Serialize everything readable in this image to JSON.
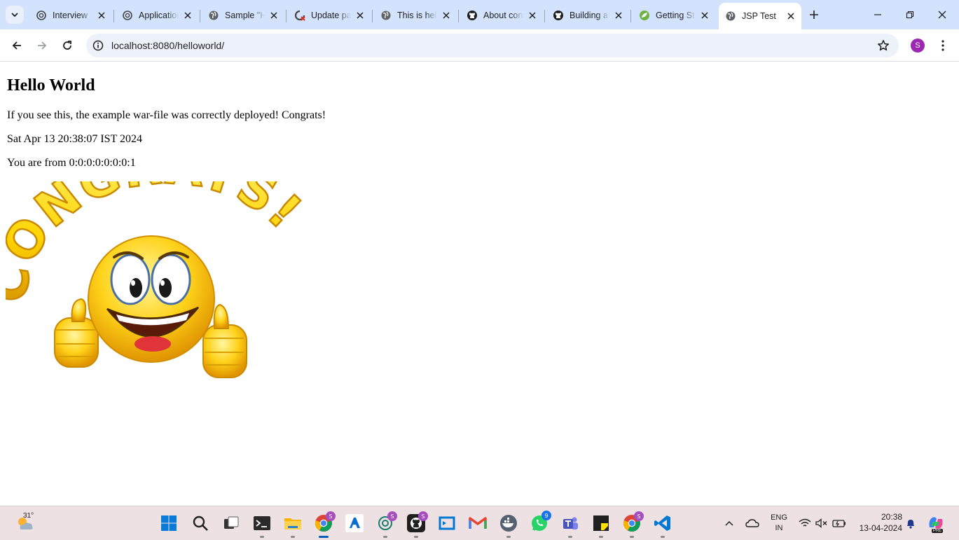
{
  "tabs": [
    {
      "title": "Interview",
      "icon": "openai-icon",
      "active": false
    },
    {
      "title": "Application",
      "icon": "openai-icon",
      "active": false
    },
    {
      "title": "Sample \"Hello",
      "icon": "globe-icon",
      "active": false
    },
    {
      "title": "Update page",
      "icon": "git-error-icon",
      "active": false
    },
    {
      "title": "This is help",
      "icon": "globe-icon",
      "active": false
    },
    {
      "title": "About con",
      "icon": "github-icon",
      "active": false
    },
    {
      "title": "Building a",
      "icon": "github-icon",
      "active": false
    },
    {
      "title": "Getting St",
      "icon": "spring-icon",
      "active": false
    },
    {
      "title": "JSP Test",
      "icon": "globe-icon",
      "active": true
    }
  ],
  "toolbar": {
    "url": "localhost:8080/helloworld/",
    "profile_initial": "S"
  },
  "page": {
    "heading": "Hello World",
    "line1": "If you see this, the example war-file was correctly deployed! Congrats!",
    "line2": "Sat Apr 13 20:38:07 IST 2024",
    "line3": "You are from 0:0:0:0:0:0:0:1",
    "image_text": "CONGRATS!"
  },
  "taskbar": {
    "weather_temp": "31°",
    "apps": [
      {
        "name": "start-icon"
      },
      {
        "name": "search-icon"
      },
      {
        "name": "task-view-icon"
      },
      {
        "name": "terminal-icon"
      },
      {
        "name": "file-explorer-icon"
      },
      {
        "name": "chrome-icon",
        "badge": "S"
      },
      {
        "name": "azure-icon"
      },
      {
        "name": "chatgpt-icon",
        "badge": "S"
      },
      {
        "name": "github-icon",
        "badge": "S"
      },
      {
        "name": "vs-studio-icon"
      },
      {
        "name": "gmail-icon"
      },
      {
        "name": "docker-icon"
      },
      {
        "name": "whatsapp-icon",
        "badge": "9"
      },
      {
        "name": "teams-icon"
      },
      {
        "name": "sticky-notes-icon"
      },
      {
        "name": "chrome-icon",
        "badge": "S"
      },
      {
        "name": "vscode-icon"
      }
    ],
    "lang_line1": "ENG",
    "lang_line2": "IN",
    "time": "20:38",
    "date": "13-04-2024",
    "copilot_label": "PRE"
  }
}
